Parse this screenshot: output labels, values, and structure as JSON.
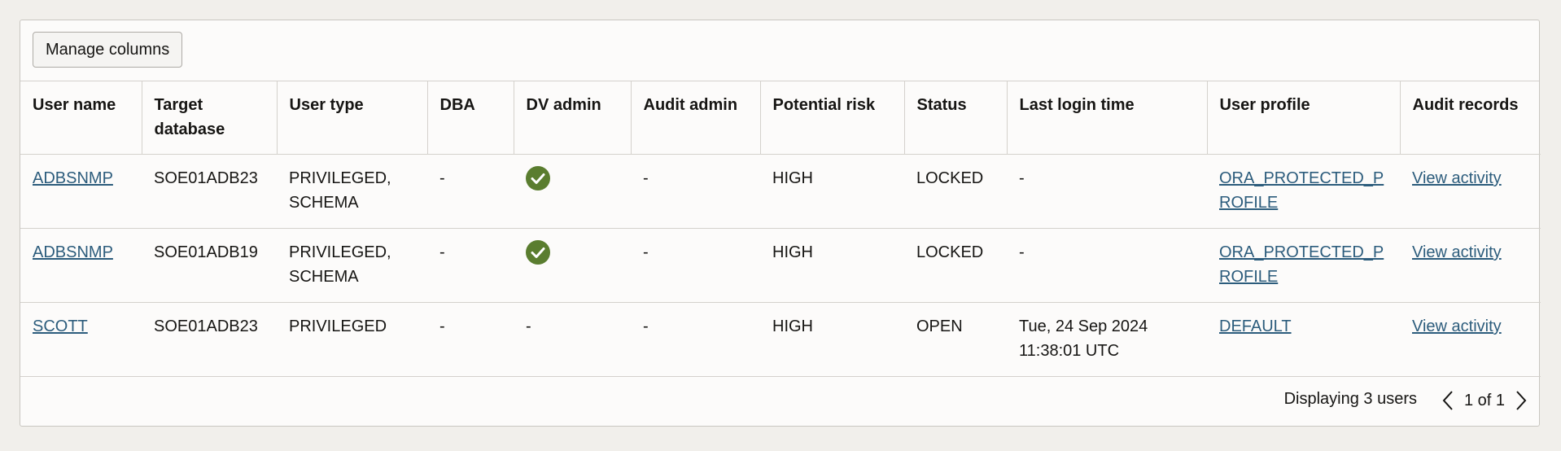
{
  "toolbar": {
    "manage_columns_label": "Manage columns"
  },
  "columns": {
    "user_name": "User name",
    "target_database": "Target database",
    "user_type": "User type",
    "dba": "DBA",
    "dv_admin": "DV admin",
    "audit_admin": "Audit admin",
    "potential_risk": "Potential risk",
    "status": "Status",
    "last_login_time": "Last login time",
    "user_profile": "User profile",
    "audit_records": "Audit records"
  },
  "rows": [
    {
      "user_name": "ADBSNMP",
      "target_database": "SOE01ADB23",
      "user_type": "PRIVILEGED, SCHEMA",
      "dba": "-",
      "dv_admin": "check-icon",
      "audit_admin": "-",
      "potential_risk": "HIGH",
      "status": "LOCKED",
      "last_login_time": "-",
      "user_profile": "ORA_PROTECTED_PROFILE",
      "audit_records": "View activity"
    },
    {
      "user_name": "ADBSNMP",
      "target_database": "SOE01ADB19",
      "user_type": "PRIVILEGED, SCHEMA",
      "dba": "-",
      "dv_admin": "check-icon",
      "audit_admin": "-",
      "potential_risk": "HIGH",
      "status": "LOCKED",
      "last_login_time": "-",
      "user_profile": "ORA_PROTECTED_PROFILE",
      "audit_records": "View activity"
    },
    {
      "user_name": "SCOTT",
      "target_database": "SOE01ADB23",
      "user_type": "PRIVILEGED",
      "dba": "-",
      "dv_admin": "-",
      "audit_admin": "-",
      "potential_risk": "HIGH",
      "status": "OPEN",
      "last_login_time": "Tue, 24 Sep 2024 11:38:01 UTC",
      "user_profile": "DEFAULT",
      "audit_records": "View activity"
    }
  ],
  "footer": {
    "count_text": "Displaying 3 users",
    "page_text": "1 of 1"
  },
  "colors": {
    "check_green": "#5a7d2f",
    "link": "#2c5c7c"
  }
}
